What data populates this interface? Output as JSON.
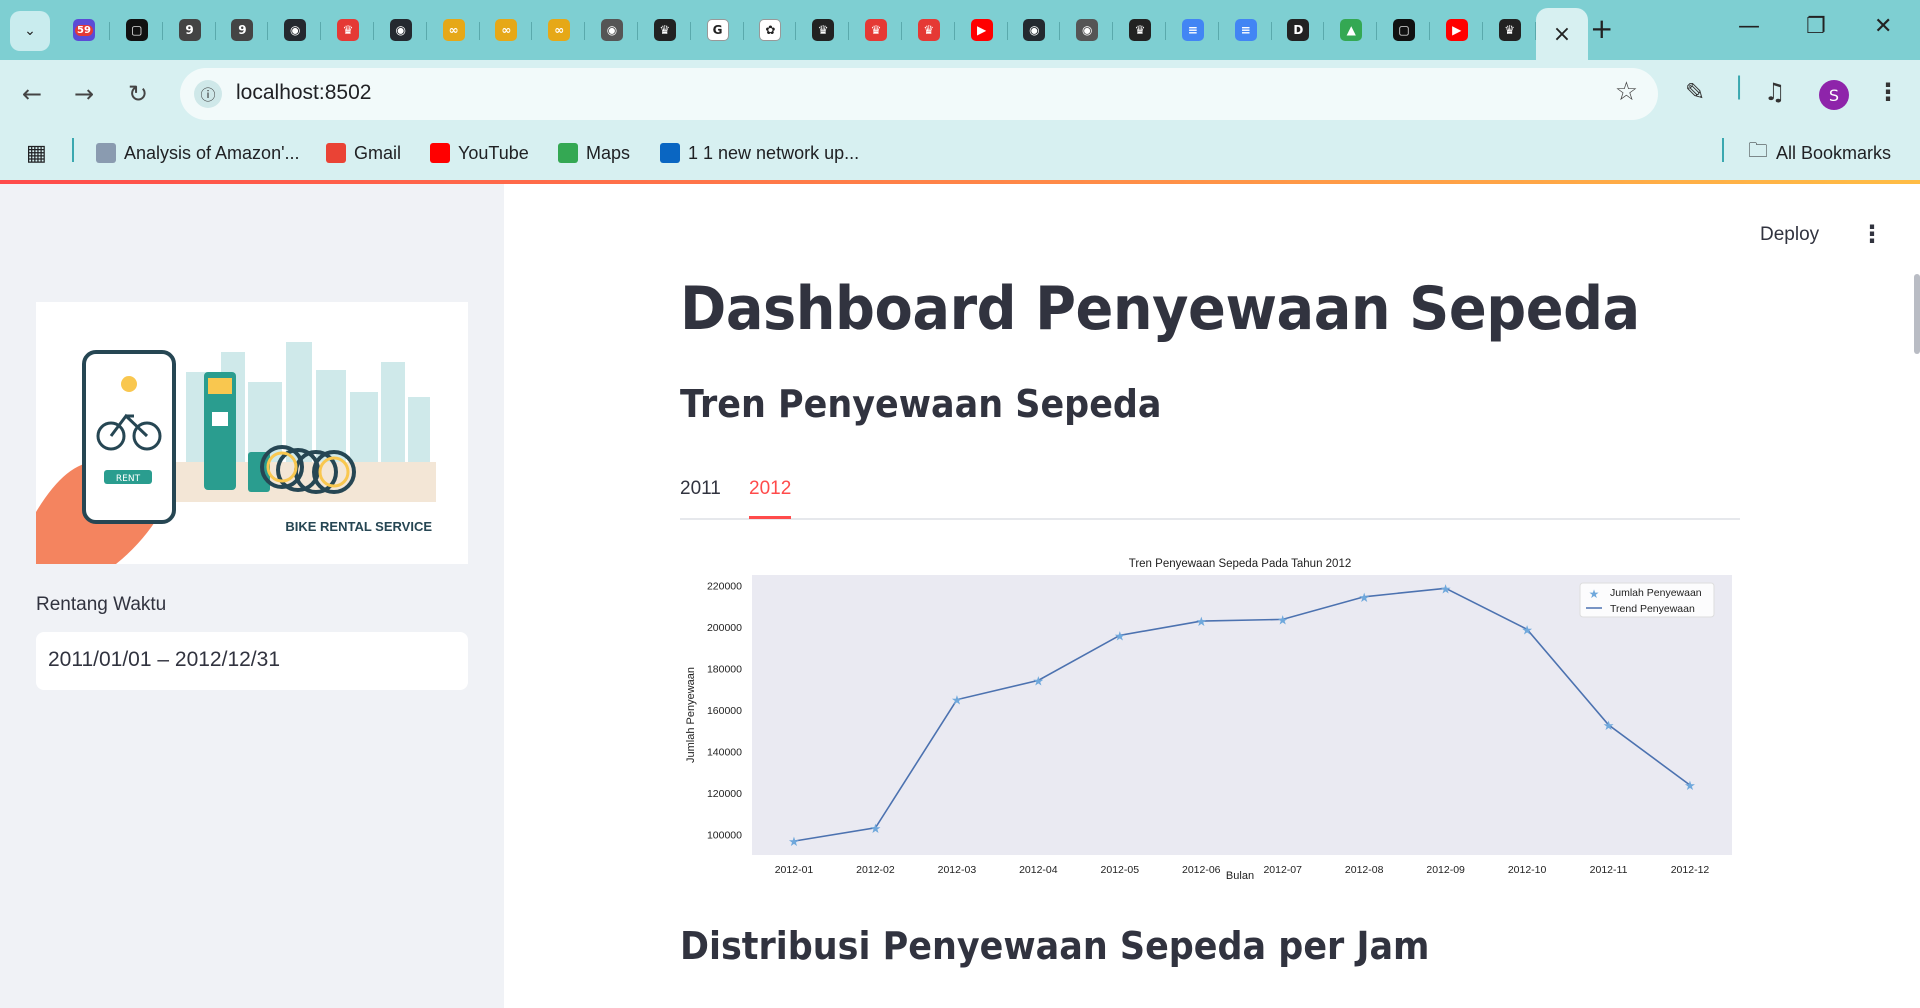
{
  "browser": {
    "tab_count_badge": "59",
    "tabs": [
      {
        "icon": "notification-badge-icon",
        "color": "#5b4bd6"
      },
      {
        "icon": "green-square-icon",
        "color": "#111111"
      },
      {
        "icon": "g-letter-icon",
        "color": "#444444",
        "glyph": "9"
      },
      {
        "icon": "g-letter-icon",
        "color": "#444444",
        "glyph": "9"
      },
      {
        "icon": "github-icon",
        "color": "#24292f"
      },
      {
        "icon": "crown-icon",
        "color": "#e53935"
      },
      {
        "icon": "github-icon",
        "color": "#24292f"
      },
      {
        "icon": "infinity-icon",
        "color": "#e6a817"
      },
      {
        "icon": "infinity-icon",
        "color": "#e6a817"
      },
      {
        "icon": "infinity-icon",
        "color": "#e6a817"
      },
      {
        "icon": "chrome-icon",
        "color": "#555555"
      },
      {
        "icon": "crown-dark-icon",
        "color": "#222222"
      },
      {
        "icon": "google-icon",
        "color": "#ffffff"
      },
      {
        "icon": "openai-icon",
        "color": "#ffffff"
      },
      {
        "icon": "crown-dark-icon",
        "color": "#222222"
      },
      {
        "icon": "crown-icon",
        "color": "#e53935"
      },
      {
        "icon": "crown-icon",
        "color": "#e53935"
      },
      {
        "icon": "youtube-icon",
        "color": "#ff0000"
      },
      {
        "icon": "github-icon",
        "color": "#24292f"
      },
      {
        "icon": "chrome-icon",
        "color": "#555555"
      },
      {
        "icon": "crown-dark-icon",
        "color": "#222222"
      },
      {
        "icon": "docs-icon",
        "color": "#4285f4"
      },
      {
        "icon": "docs-icon",
        "color": "#4285f4"
      },
      {
        "icon": "d-letter-icon",
        "color": "#222222",
        "glyph": "D"
      },
      {
        "icon": "drive-icon",
        "color": "#34a853"
      },
      {
        "icon": "green-square-icon",
        "color": "#111111"
      },
      {
        "icon": "youtube-icon",
        "color": "#ff0000"
      },
      {
        "icon": "crown-dark-icon",
        "color": "#222222"
      }
    ],
    "url": "localhost:8502",
    "profile_initial": "S",
    "bookmarks": [
      {
        "label": "Analysis of Amazon'...",
        "icon": "document-icon",
        "color": "#8a9bb0"
      },
      {
        "label": "Gmail",
        "icon": "gmail-icon",
        "color": "#ea4335"
      },
      {
        "label": "YouTube",
        "icon": "youtube-icon",
        "color": "#ff0000"
      },
      {
        "label": "Maps",
        "icon": "maps-icon",
        "color": "#34a853"
      },
      {
        "label": "1 1 new network up...",
        "icon": "linkedin-icon",
        "color": "#0a66c2"
      }
    ],
    "all_bookmarks": "All Bookmarks"
  },
  "sidebar": {
    "image_caption": "BIKE RENTAL SERVICE",
    "image_rent_label": "RENT",
    "date_label": "Rentang Waktu",
    "date_value": "2011/01/01 – 2012/12/31"
  },
  "header": {
    "deploy": "Deploy"
  },
  "main": {
    "title": "Dashboard Penyewaan Sepeda",
    "section1": "Tren Penyewaan Sepeda",
    "tabs": [
      {
        "label": "2011",
        "active": false
      },
      {
        "label": "2012",
        "active": true
      }
    ],
    "section2": "Distribusi Penyewaan Sepeda per Jam"
  },
  "chart_data": {
    "type": "line",
    "title": "Tren Penyewaan Sepeda Pada Tahun 2012",
    "xlabel": "Bulan",
    "ylabel": "Jumlah Penyewaan",
    "categories": [
      "2012-01",
      "2012-02",
      "2012-03",
      "2012-04",
      "2012-05",
      "2012-06",
      "2012-07",
      "2012-08",
      "2012-09",
      "2012-10",
      "2012-11",
      "2012-12"
    ],
    "series": [
      {
        "name": "Jumlah Penyewaan",
        "marker": "star",
        "values": [
          96700,
          103100,
          164900,
          174200,
          195900,
          202800,
          203600,
          214500,
          218600,
          198800,
          152700,
          123700
        ]
      },
      {
        "name": "Trend Penyewaan",
        "marker": "line",
        "values": [
          96700,
          103100,
          164900,
          174200,
          195900,
          202800,
          203600,
          214500,
          218600,
          198800,
          152700,
          123700
        ]
      }
    ],
    "yticks": [
      100000,
      120000,
      140000,
      160000,
      180000,
      200000,
      220000
    ],
    "ylim": [
      90000,
      225000
    ],
    "grid": false,
    "legend": "top-right",
    "colors": {
      "line": "#4c72b0",
      "marker": "#6fa8dc",
      "plot_bg": "#eaeaf2"
    }
  }
}
